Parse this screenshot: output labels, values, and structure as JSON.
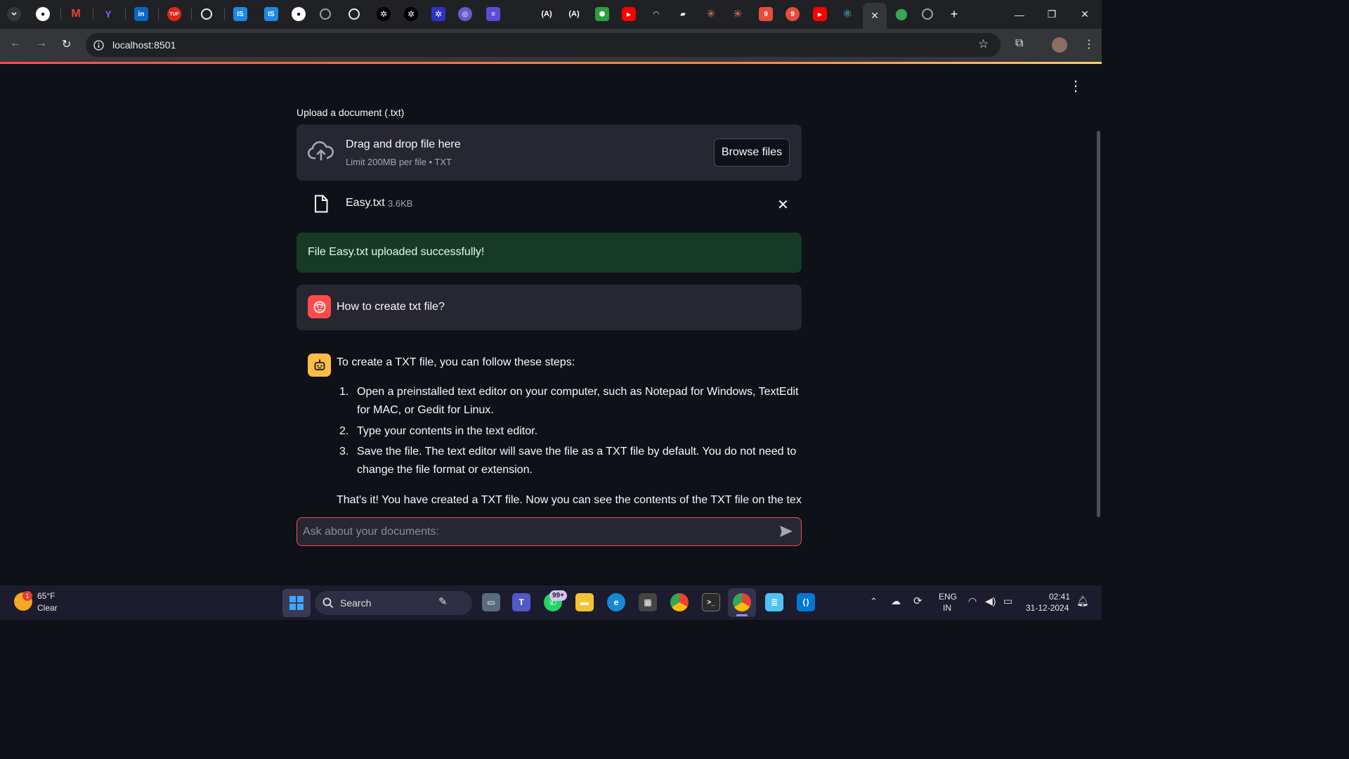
{
  "browser": {
    "url": "localhost:8501",
    "active_tab_close": "✕",
    "new_tab": "+"
  },
  "app": {
    "upload_label": "Upload a document (.txt)",
    "dropzone": {
      "title": "Drag and drop file here",
      "limit": "Limit 200MB per file • TXT",
      "browse_label": "Browse files"
    },
    "uploaded_file": {
      "name": "Easy.txt",
      "size": "3.6KB"
    },
    "success_message": "File Easy.txt uploaded successfully!",
    "user_message": "How to create txt file?",
    "assistant_message": {
      "intro": "To create a TXT file, you can follow these steps:",
      "steps": [
        {
          "num": "1.",
          "text": "Open a preinstalled text editor on your computer, such as Notepad for Windows, TextEdit for MAC, or Gedit for Linux."
        },
        {
          "num": "2.",
          "text": "Type your contents in the text editor."
        },
        {
          "num": "3.",
          "text": "Save the file. The text editor will save the file as a TXT file by default. You do not need to change the file format or extension."
        }
      ],
      "outro": "That's it! You have created a TXT file. Now you can see the contents of the TXT file on the text"
    },
    "chat_input_placeholder": "Ask about your documents:"
  },
  "taskbar": {
    "weather_temp": "65°F",
    "weather_cond": "Clear",
    "weather_badge": "1",
    "search_label": "Search",
    "whatsapp_badge": "99+",
    "lang_top": "ENG",
    "lang_bottom": "IN",
    "time": "02:41",
    "date": "31-12-2024"
  },
  "colors": {
    "accent": "#ff4b4b",
    "background": "#0e1117",
    "surface": "#262730",
    "success_bg": "#173928",
    "bot_avatar": "#ffbd45"
  }
}
